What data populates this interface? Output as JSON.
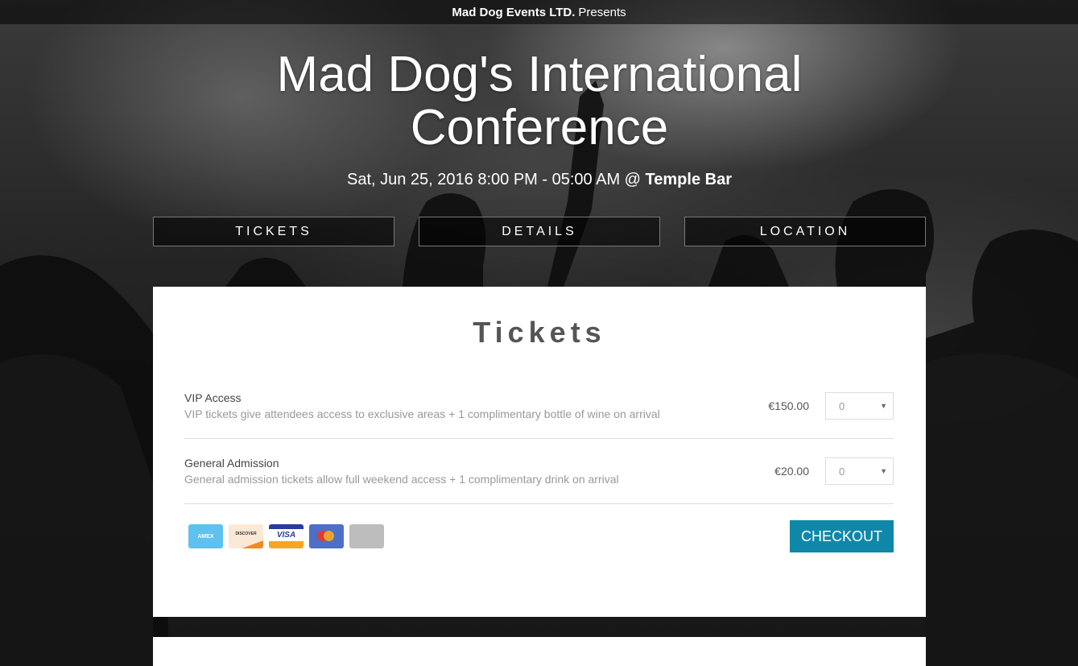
{
  "topbar": {
    "organizer": "Mad Dog Events LTD.",
    "presents": "Presents"
  },
  "event": {
    "title": "Mad Dog's International Conference",
    "datetime": "Sat, Jun 25, 2016 8:00 PM - 05:00 AM @",
    "venue": "Temple Bar"
  },
  "nav": {
    "tickets": "TICKETS",
    "details": "DETAILS",
    "location": "LOCATION"
  },
  "tickets_section": {
    "heading": "Tickets",
    "items": [
      {
        "name": "VIP Access",
        "description": "VIP tickets give attendees access to exclusive areas + 1 complimentary bottle of wine on arrival",
        "price": "€150.00",
        "quantity": "0"
      },
      {
        "name": "General Admission",
        "description": "General admission tickets allow full weekend access + 1 complimentary drink on arrival",
        "price": "€20.00",
        "quantity": "0"
      }
    ],
    "payment_cards": {
      "amex": "AMEX",
      "discover": "DISCOVER",
      "visa": "VISA"
    },
    "checkout_label": "CHECKOUT"
  },
  "colors": {
    "accent": "#0f87a8"
  },
  "icons": [
    "amex-card-icon",
    "discover-card-icon",
    "visa-card-icon",
    "mastercard-icon",
    "generic-card-icon",
    "chevron-down-icon"
  ]
}
